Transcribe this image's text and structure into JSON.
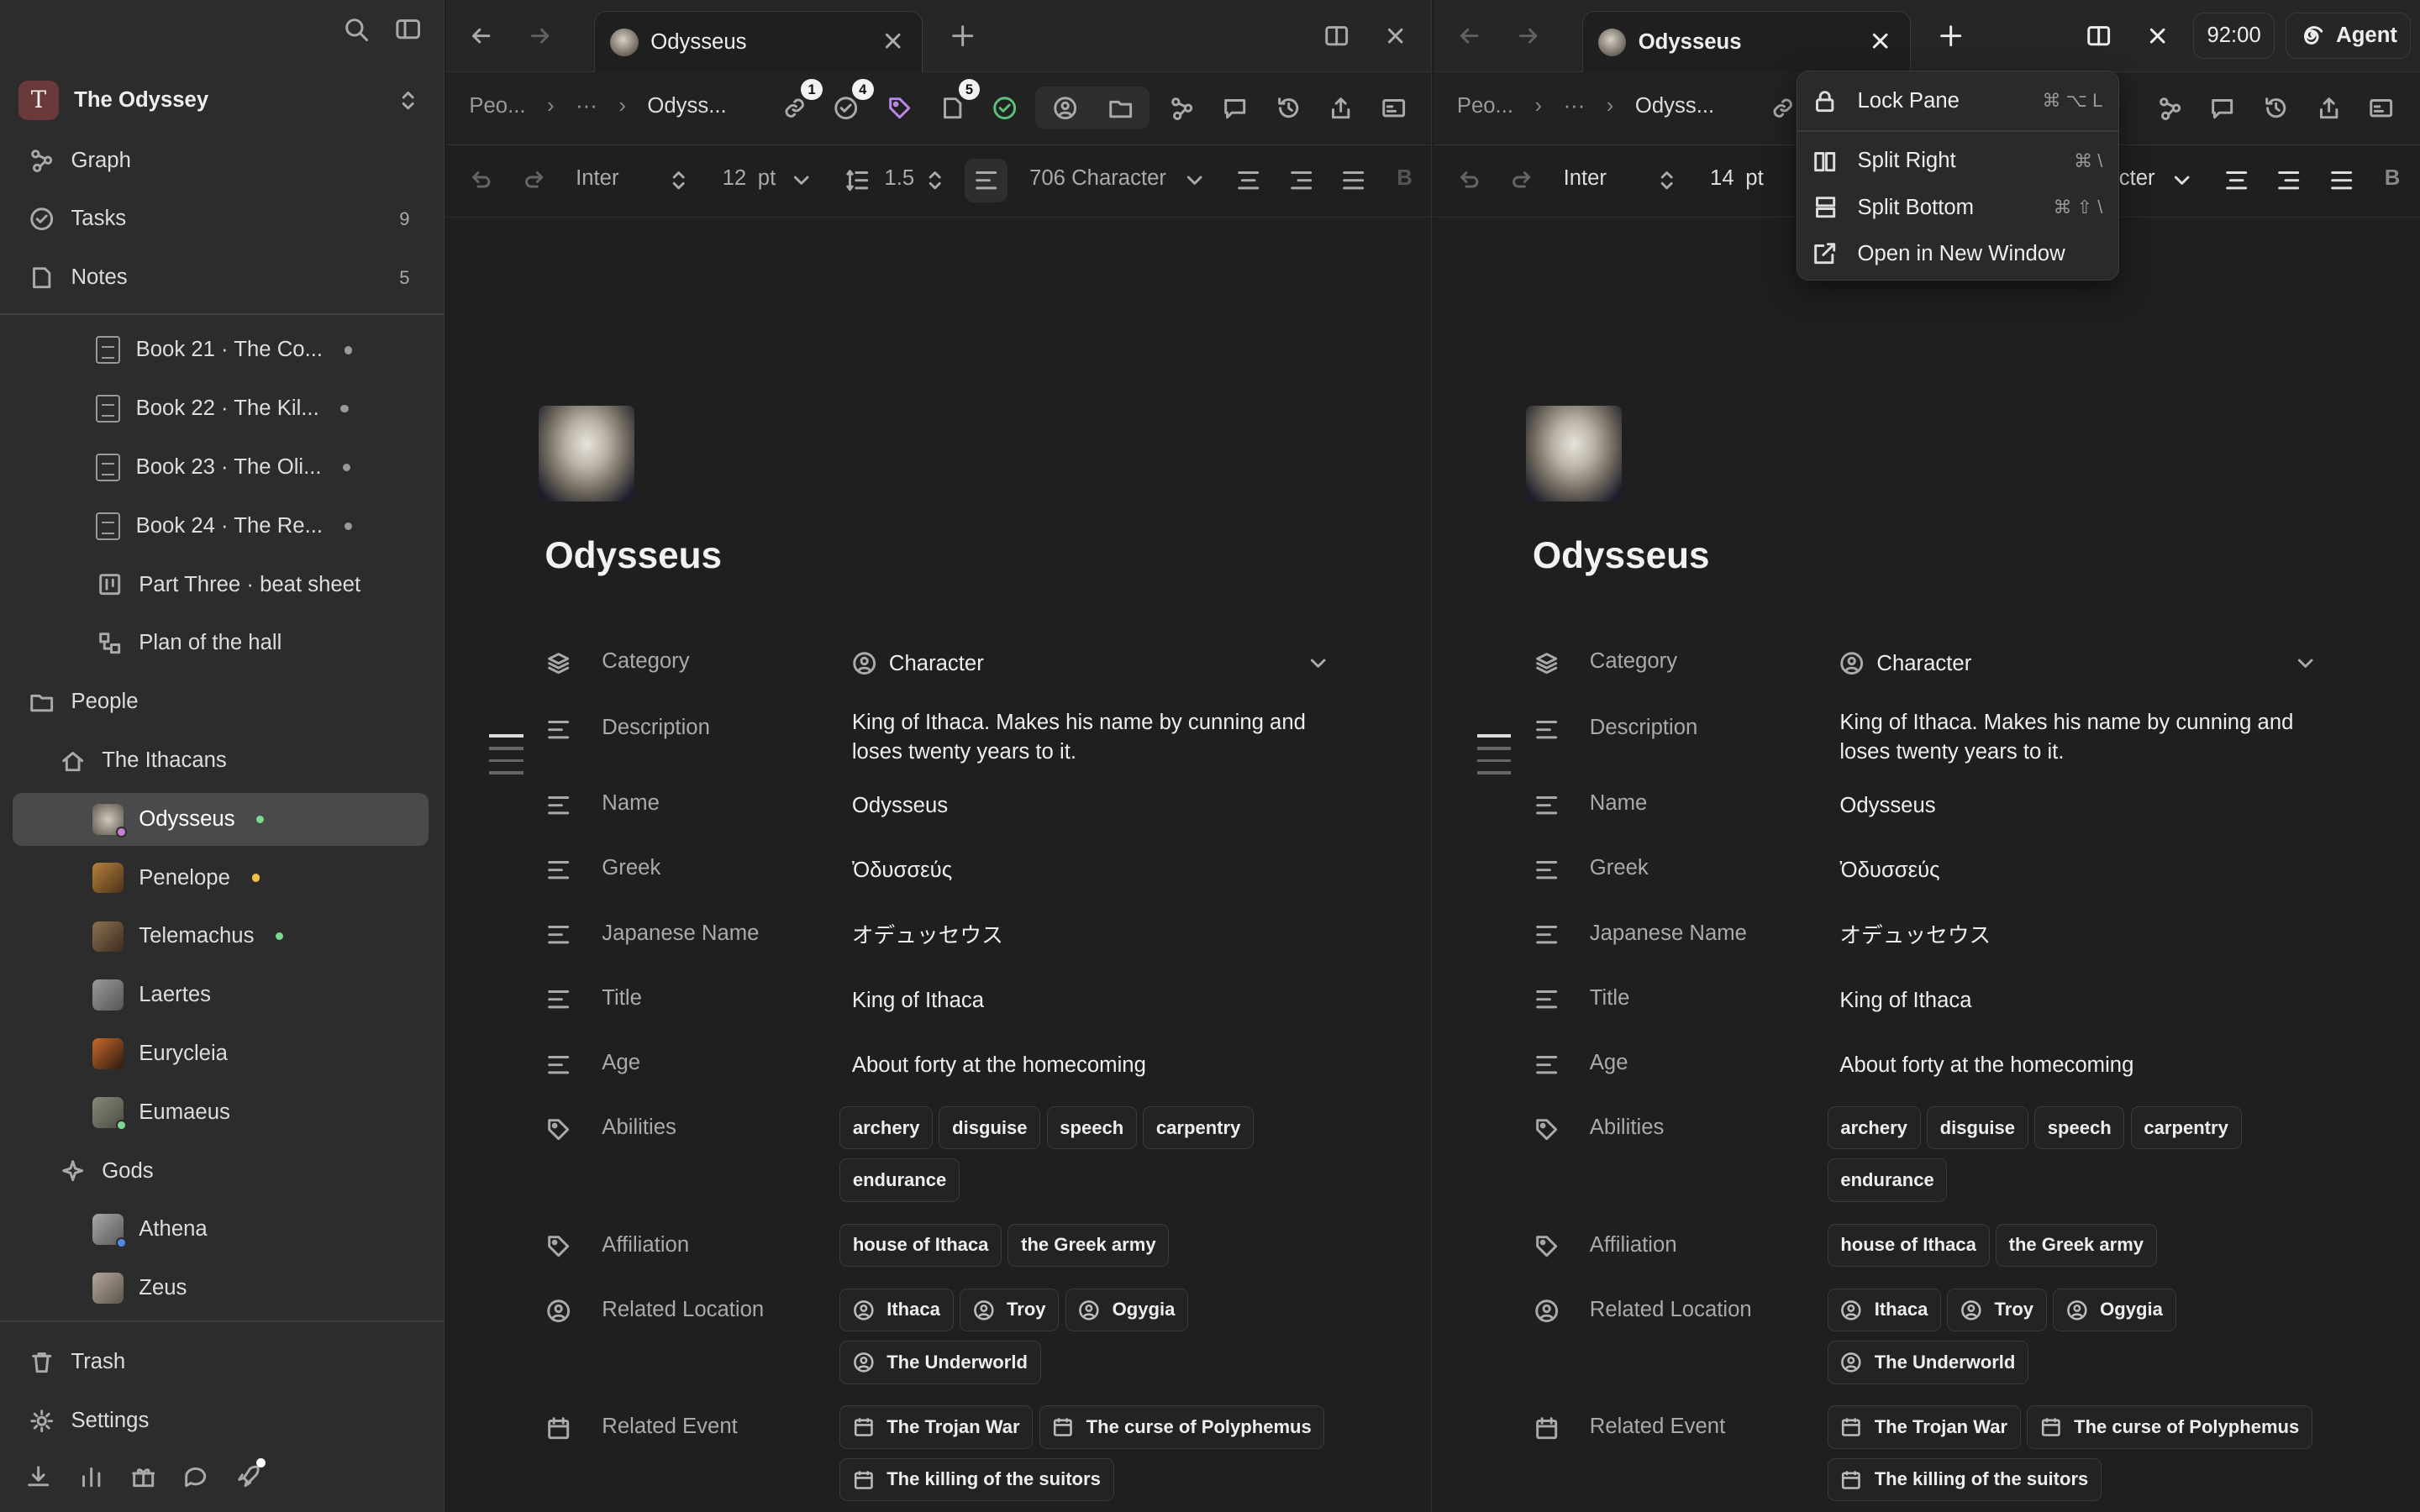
{
  "workspace": {
    "initial": "T",
    "name": "The Odyssey"
  },
  "nav": {
    "graph": "Graph",
    "tasks": {
      "label": "Tasks",
      "count": "9"
    },
    "notes": {
      "label": "Notes",
      "count": "5"
    }
  },
  "tree": {
    "book21": "Book 21 · The Co...",
    "book22": "Book 22 · The Kil...",
    "book23": "Book 23 · The Oli...",
    "book24": "Book 24 · The Re...",
    "beat": "Part Three · beat sheet",
    "plan": "Plan of the hall",
    "people": "People",
    "ithacans": "The Ithacans",
    "odysseus": "Odysseus",
    "penelope": "Penelope",
    "telemachus": "Telemachus",
    "laertes": "Laertes",
    "eurycleia": "Eurycleia",
    "eumaeus": "Eumaeus",
    "gods": "Gods",
    "athena": "Athena",
    "zeus": "Zeus"
  },
  "footer": {
    "trash": "Trash",
    "settings": "Settings"
  },
  "left": {
    "tab_title": "Odysseus",
    "crumb_parent": "Peo...",
    "crumb_ellipsis": "···",
    "crumb_current": "Odyss...",
    "badges": {
      "links": "1",
      "tasks": "4",
      "notes": "5"
    },
    "font": "Inter",
    "size": "12",
    "unit": "pt",
    "spacing": "1.5",
    "template": "706 Character"
  },
  "right": {
    "tab_title": "Odysseus",
    "crumb_parent": "Peo...",
    "crumb_ellipsis": "···",
    "crumb_current": "Odyss...",
    "font": "Inter",
    "size": "14",
    "unit": "pt",
    "template_partial": "cter"
  },
  "clock": "92:00",
  "agent": "Agent",
  "menu": [
    {
      "label": "Lock Pane",
      "shortcut": "⌘ ⌥ L"
    },
    {
      "label": "Split Right",
      "shortcut": "⌘ \\"
    },
    {
      "label": "Split Bottom",
      "shortcut": "⌘ ⇧ \\"
    },
    {
      "label": "Open in New Window",
      "shortcut": ""
    }
  ],
  "doc": {
    "title": "Odysseus",
    "category": {
      "label": "Category",
      "value": "Character"
    },
    "description": {
      "label": "Description",
      "value": "King of Ithaca. Makes his name by cunning and loses twenty years to it."
    },
    "name": {
      "label": "Name",
      "value": "Odysseus"
    },
    "greek": {
      "label": "Greek",
      "value": "Ὀδυσσεύς"
    },
    "japanese": {
      "label": "Japanese Name",
      "value": "オデュッセウス"
    },
    "title_prop": {
      "label": "Title",
      "value": "King of Ithaca"
    },
    "age": {
      "label": "Age",
      "value": "About forty at the homecoming"
    },
    "abilities": {
      "label": "Abilities",
      "values": [
        "archery",
        "disguise",
        "speech",
        "carpentry",
        "endurance"
      ]
    },
    "affiliation": {
      "label": "Affiliation",
      "values": [
        "house of Ithaca",
        "the Greek army"
      ]
    },
    "location": {
      "label": "Related Location",
      "values": [
        "Ithaca",
        "Troy",
        "Ogygia",
        "The Underworld"
      ]
    },
    "event": {
      "label": "Related Event",
      "values": [
        "The Trojan War",
        "The curse of Polyphemus",
        "The killing of the suitors"
      ]
    }
  },
  "colors": {
    "bg": "#1f1f1f",
    "sidebar": "#2c2c2c",
    "selected": "#4a4a4a",
    "green_dot": "#7bd88f",
    "yellow_dot": "#f0c04a"
  }
}
